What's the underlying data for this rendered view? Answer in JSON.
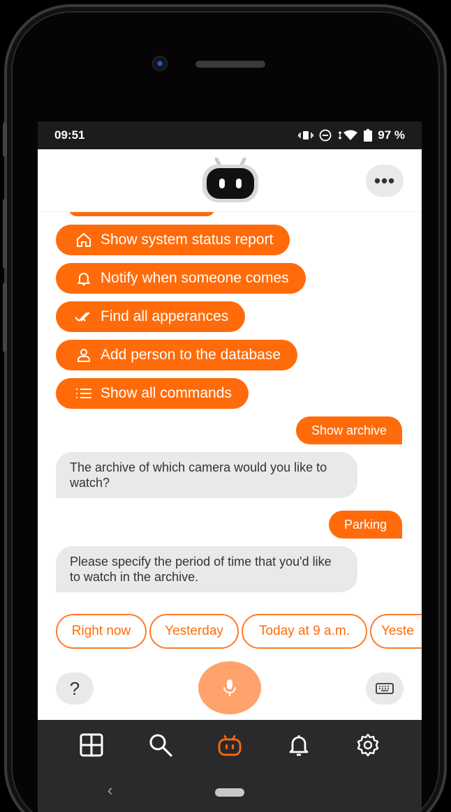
{
  "status_bar": {
    "time": "09:51",
    "battery": "97 %"
  },
  "header": {
    "more_label": "•••"
  },
  "commands": [
    {
      "label": "Show system status report",
      "icon": "home-icon"
    },
    {
      "label": "Notify when someone comes",
      "icon": "bell-icon"
    },
    {
      "label": "Find all apperances",
      "icon": "double-check-icon"
    },
    {
      "label": "Add person to the database",
      "icon": "person-icon"
    },
    {
      "label": "Show all commands",
      "icon": "list-icon"
    }
  ],
  "messages": [
    {
      "from": "user",
      "text": "Show archive"
    },
    {
      "from": "bot",
      "text": "The archive of which camera would you like to watch?"
    },
    {
      "from": "user",
      "text": "Parking"
    },
    {
      "from": "bot",
      "text": "Please specify the period of time that you'd like to watch in the archive."
    }
  ],
  "quick_replies": [
    "Right now",
    "Yesterday",
    "Today at 9 a.m.",
    "Yeste"
  ],
  "input_bar": {
    "help_label": "?"
  },
  "tabs": [
    {
      "name": "grid",
      "icon": "grid-icon",
      "active": false
    },
    {
      "name": "search",
      "icon": "search-icon",
      "active": false
    },
    {
      "name": "bot",
      "icon": "bot-icon",
      "active": true
    },
    {
      "name": "notifications",
      "icon": "bell-icon",
      "active": false
    },
    {
      "name": "settings",
      "icon": "gear-icon",
      "active": false
    }
  ],
  "colors": {
    "accent": "#ff6b0a",
    "mic": "#ffa26b",
    "bubble": "#e9e9ec",
    "tabbar": "#2a2a2c"
  }
}
